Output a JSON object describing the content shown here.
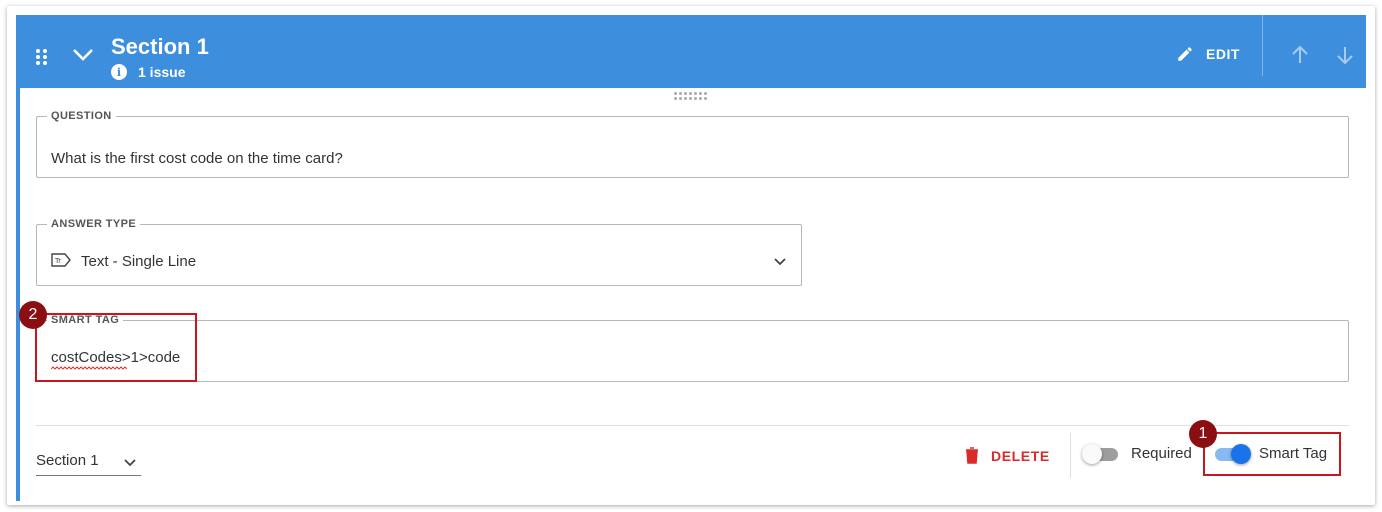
{
  "header": {
    "title": "Section 1",
    "issue_text": "1 issue",
    "edit_label": "EDIT"
  },
  "question": {
    "legend": "QUESTION",
    "value": "What is the first cost code on the time card?"
  },
  "answer_type": {
    "legend": "ANSWER TYPE",
    "value": "Text - Single Line"
  },
  "smart_tag_field": {
    "legend": "SMART TAG",
    "value": "costCodes>1>code"
  },
  "footer": {
    "section_select": "Section 1",
    "delete_label": "DELETE",
    "required_label": "Required",
    "required_on": false,
    "smart_tag_label": "Smart Tag",
    "smart_tag_on": true
  },
  "annotations": {
    "badge_1": "1",
    "badge_2": "2"
  },
  "colors": {
    "header": "#3d8fdd",
    "delete": "#d92b2b",
    "toggle_on": "#1a73e8",
    "annotation": "#c8161d",
    "badge": "#8b0f12"
  }
}
